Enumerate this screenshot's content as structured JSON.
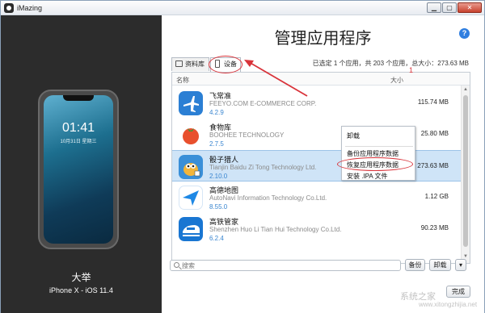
{
  "window": {
    "title": "iMazing",
    "min": "▁",
    "max": "▢",
    "close": "✕"
  },
  "device": {
    "clock": "01:41",
    "date": "10月31日 星期三",
    "name": "大举",
    "model": "iPhone X - iOS 11.4"
  },
  "header": {
    "title": "管理应用程序",
    "help": "?"
  },
  "tabs": [
    {
      "label": "资料库"
    },
    {
      "label": "设备"
    }
  ],
  "selection_info": "已选定 1 个应用，共 203 个应用，总大小：273.63 MB",
  "columns": {
    "name": "名称",
    "size": "大小"
  },
  "apps": [
    {
      "name": "飞常准",
      "vendor": "FEEYO.COM E-COMMERCE CORP.",
      "version": "4.2.9",
      "size": "115.74 MB",
      "icon_color": "#2b7fd4"
    },
    {
      "name": "食物库",
      "vendor": "BOOHEE TECHNOLOGY",
      "version": "2.7.5",
      "size": "25.80 MB",
      "icon_color": "#e8502d"
    },
    {
      "name": "骰子猎人",
      "vendor": "Tianjin Baidu Zi Tong Technology Ltd.",
      "version": "2.10.0",
      "size": "273.63 MB",
      "icon_color": "#3a8fd8",
      "selected": true
    },
    {
      "name": "高德地图",
      "vendor": "AutoNavi Information Technology Co.Ltd.",
      "version": "8.55.0",
      "size": "1.12 GB",
      "icon_color": "#1e88e5"
    },
    {
      "name": "高铁管家",
      "vendor": "Shenzhen Huo Li Tian Hui Technology Co.Ltd.",
      "version": "6.2.4",
      "size": "90.23 MB",
      "icon_color": "#1976d2"
    }
  ],
  "context_menu": {
    "items": [
      "卸载",
      "备份应用程序数据",
      "恢复应用程序数据",
      "安装 .IPA 文件"
    ]
  },
  "annotation": {
    "number": "1"
  },
  "search": {
    "placeholder": "搜索"
  },
  "toolbar": {
    "backup_label": "备份",
    "uninstall_label": "卸载",
    "more_label": "▾",
    "done_label": "完成"
  },
  "watermark": {
    "text": "系统之家",
    "url": "www.xitongzhijia.net"
  }
}
